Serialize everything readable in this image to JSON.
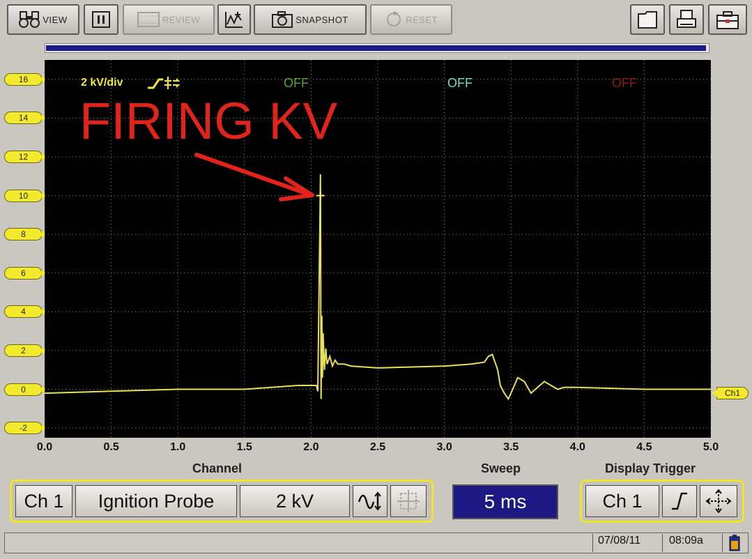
{
  "toolbar": {
    "view_label": "VIEW",
    "review_label": "REVIEW",
    "snapshot_label": "SNAPSHOT",
    "reset_label": "RESET",
    "pause_icon": "pause-icon",
    "trace_icon": "trace-marker-icon",
    "folder_icon": "folder-icon",
    "print_icon": "printer-icon",
    "toolbox_icon": "toolbox-icon"
  },
  "progress": {
    "fraction": 0.995
  },
  "scope": {
    "scale_label": "2 kV/div",
    "ch2_status": "OFF",
    "ch3_status": "OFF",
    "ch4_status": "OFF",
    "annotation": "FIRING KV",
    "channel_marker": "Ch1"
  },
  "colors": {
    "trace": "#e8e05a",
    "grid": "#8a8a8a",
    "annotation": "#e0241c",
    "ch2": "#57a63a",
    "ch3": "#7bd7c9",
    "ch4": "#8e1a12",
    "scale_label": "#f2ea3a"
  },
  "chart_data": {
    "type": "line",
    "xlim": [
      0,
      5.0
    ],
    "ylim": [
      -2.5,
      17
    ],
    "x_ticks": [
      "0.0",
      "0.5",
      "1.0",
      "1.5",
      "2.0",
      "2.5",
      "3.0",
      "3.5",
      "4.0",
      "4.5",
      "5.0"
    ],
    "y_ticks": [
      "16",
      "14",
      "12",
      "10",
      "8",
      "6",
      "4",
      "2",
      "0",
      "-2"
    ],
    "cursor": {
      "x": 2.07,
      "y": 10.0
    },
    "series": [
      {
        "x": [
          0.0,
          0.5,
          1.0,
          1.5,
          1.9,
          2.04,
          2.05,
          2.07,
          2.075,
          2.08,
          2.085,
          2.09,
          2.1,
          2.11,
          2.12,
          2.14,
          2.16,
          2.18,
          2.2,
          2.25,
          2.3,
          2.5,
          3.0,
          3.2,
          3.3,
          3.33,
          3.36,
          3.4,
          3.42,
          3.45,
          3.48,
          3.5,
          3.55,
          3.6,
          3.65,
          3.7,
          3.75,
          3.8,
          3.85,
          3.9,
          4.0,
          4.5,
          5.0
        ],
        "y": [
          -0.2,
          -0.1,
          0.0,
          0.0,
          0.2,
          0.2,
          -0.1,
          11.1,
          -0.5,
          3.8,
          0.6,
          2.9,
          1.0,
          2.1,
          1.3,
          1.7,
          1.2,
          1.5,
          1.3,
          1.3,
          1.2,
          1.1,
          1.2,
          1.3,
          1.4,
          1.7,
          1.8,
          1.0,
          0.2,
          -0.2,
          -0.5,
          -0.2,
          0.6,
          0.4,
          -0.2,
          0.1,
          0.4,
          0.2,
          0.0,
          0.1,
          0.1,
          0.0,
          0.0
        ]
      }
    ]
  },
  "axis": {
    "channel_label": "Channel",
    "sweep_label": "Sweep",
    "display_trigger_label": "Display Trigger"
  },
  "channel_panel": {
    "channel": "Ch 1",
    "probe": "Ignition Probe",
    "scale": "2 kV",
    "coupling_icon": "waveform-scale-icon",
    "auto_icon": "auto-scale-icon"
  },
  "sweep": {
    "value": "5 ms"
  },
  "trigger_panel": {
    "channel": "Ch 1",
    "slope_icon": "rising-edge-icon",
    "position_icon": "move-trigger-icon"
  },
  "status_bar": {
    "date": "07/08/11",
    "time": "08:09a",
    "battery_icon": "battery-icon"
  }
}
